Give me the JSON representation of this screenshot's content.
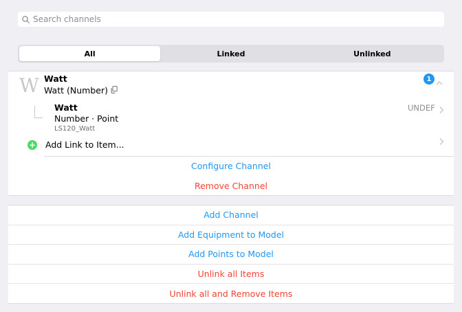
{
  "search": {
    "placeholder": "Search channels",
    "value": ""
  },
  "tabs": [
    {
      "label": "All",
      "active": true
    },
    {
      "label": "Linked",
      "active": false
    },
    {
      "label": "Unlinked",
      "active": false
    }
  ],
  "channel": {
    "initial": "W",
    "name": "Watt",
    "type": "Watt (Number)",
    "link_count": "1",
    "linked_item": {
      "name": "Watt",
      "type": "Number · Point",
      "id": "LS120_Watt",
      "state": "UNDEF"
    },
    "add_link_label": "Add Link to Item...",
    "configure_label": "Configure Channel",
    "remove_label": "Remove Channel"
  },
  "actions": [
    {
      "label": "Add Channel",
      "color": "#2196f3"
    },
    {
      "label": "Add Equipment to Model",
      "color": "#2196f3"
    },
    {
      "label": "Add Points to Model",
      "color": "#2196f3"
    },
    {
      "label": "Unlink all Items",
      "color": "#f44336"
    },
    {
      "label": "Unlink all and Remove Items",
      "color": "#f44336"
    }
  ],
  "colors": {
    "accent": "#2196f3",
    "danger": "#f44336",
    "success": "#4cd964"
  }
}
